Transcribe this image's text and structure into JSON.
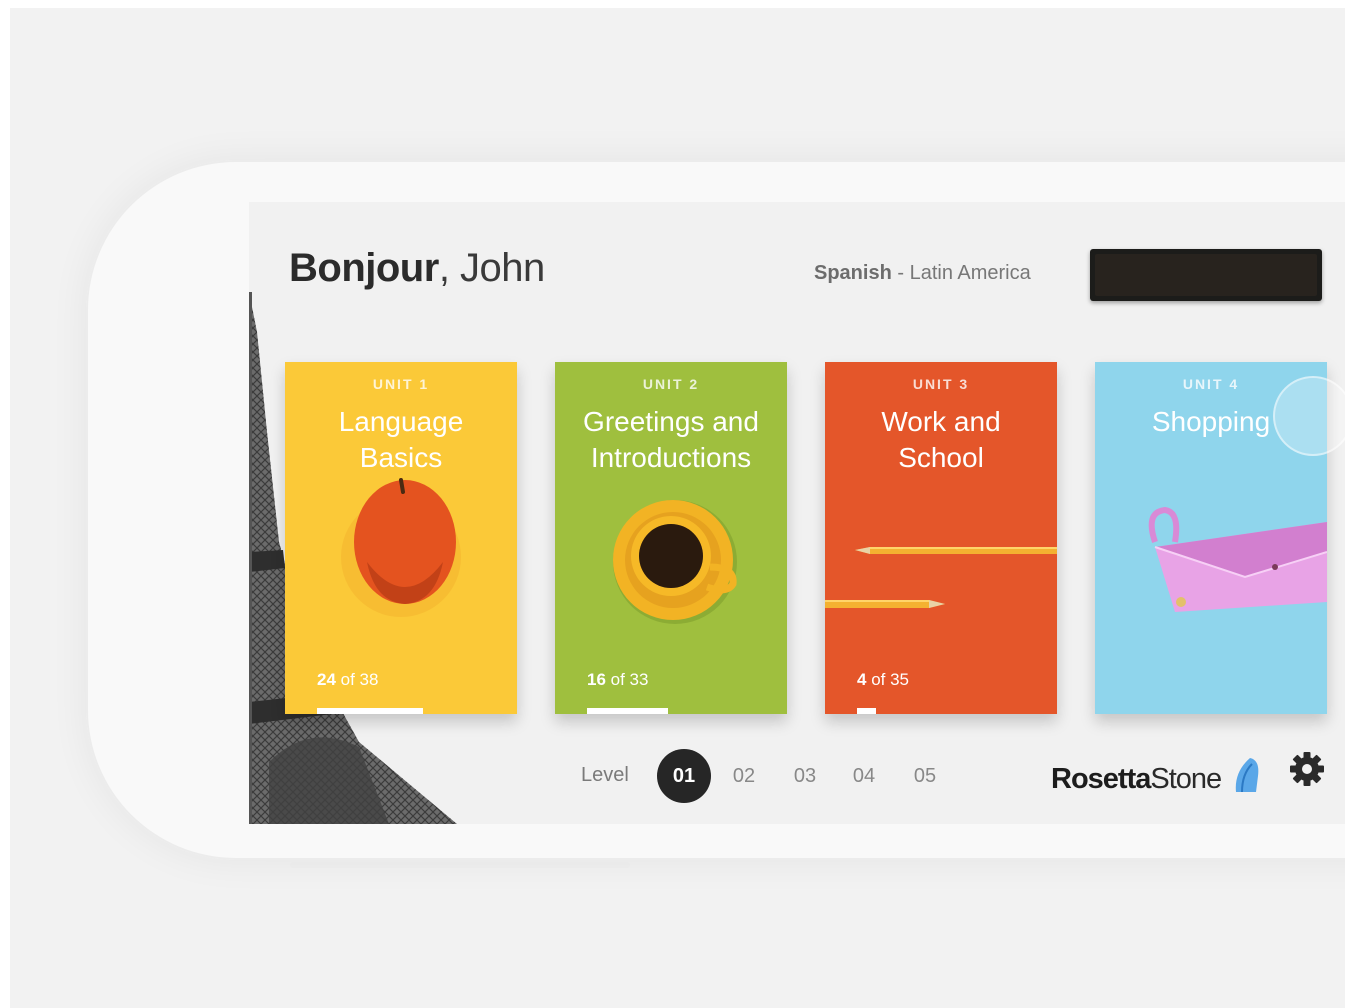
{
  "header": {
    "greeting_bold": "Bonjour",
    "greeting_rest": ", John",
    "language_primary": "Spanish",
    "language_sep": " - ",
    "language_region": "Latin America"
  },
  "units": [
    {
      "unit_label": "UNIT 1",
      "title_line1": "Language",
      "title_line2": "Basics",
      "done": "24",
      "of_text": " of 38",
      "completed": 24,
      "total": 38,
      "color": "#fbc938",
      "icon": "apple-icon"
    },
    {
      "unit_label": "UNIT 2",
      "title_line1": "Greetings and",
      "title_line2": "Introductions",
      "done": "16",
      "of_text": " of 33",
      "completed": 16,
      "total": 33,
      "color": "#9fbf3e",
      "icon": "coffee-cup-icon"
    },
    {
      "unit_label": "UNIT 3",
      "title_line1": "Work and",
      "title_line2": "School",
      "done": "4",
      "of_text": " of 35",
      "completed": 4,
      "total": 35,
      "color": "#e4562a",
      "icon": "pencil-icon"
    },
    {
      "unit_label": "UNIT 4",
      "title_line1": "Shopping",
      "title_line2": "",
      "color": "#8fd5ec",
      "icon": "purse-icon"
    }
  ],
  "footer": {
    "level_label": "Level",
    "levels": [
      "01",
      "02",
      "03",
      "04",
      "05"
    ],
    "active_level": "01",
    "brand_part1": "Rosetta",
    "brand_part2": "Stone",
    "settings_icon": "gear-icon"
  }
}
